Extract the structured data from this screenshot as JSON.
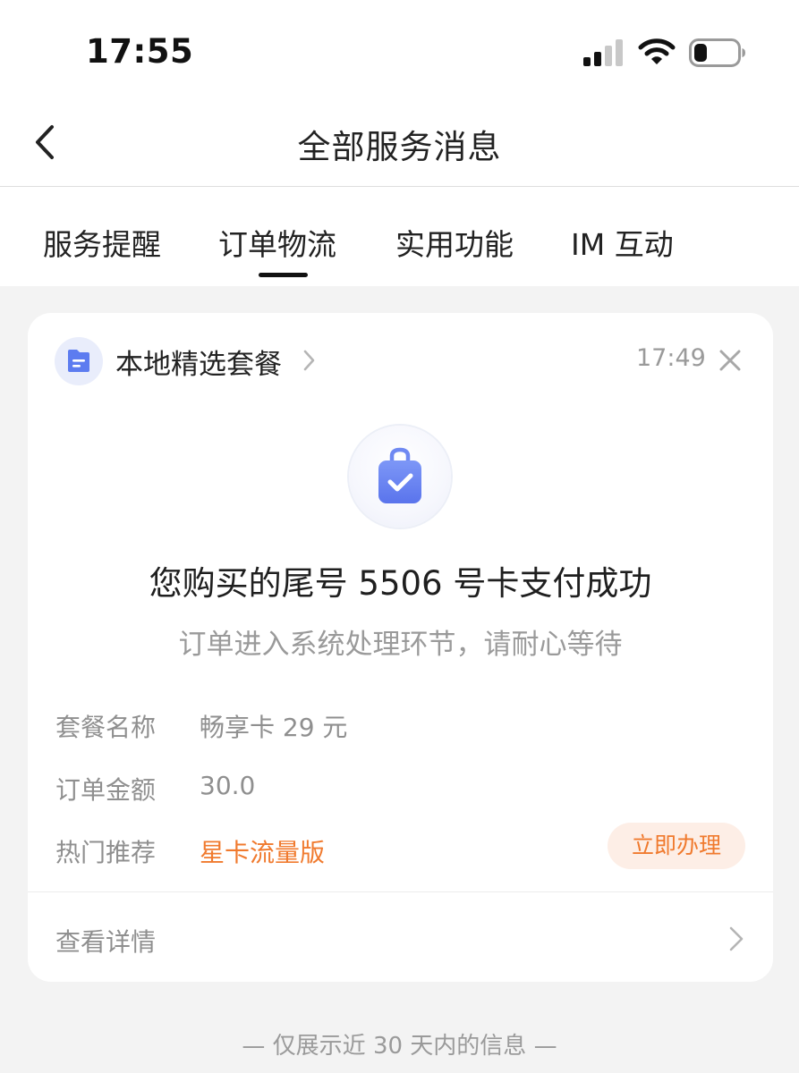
{
  "status_bar": {
    "time": "17:55"
  },
  "nav": {
    "title": "全部服务消息"
  },
  "tabs": [
    {
      "label": "服务提醒"
    },
    {
      "label": "订单物流"
    },
    {
      "label": "实用功能"
    },
    {
      "label": "IM 互动"
    }
  ],
  "active_tab_index": 1,
  "message": {
    "source": "本地精选套餐",
    "time": "17:49",
    "headline": "您购买的尾号 5506 号卡支付成功",
    "subline": "订单进入系统处理环节，请耐心等待",
    "details": [
      {
        "label": "套餐名称",
        "value": "畅享卡 29 元"
      },
      {
        "label": "订单金额",
        "value": "30.0"
      },
      {
        "label": "热门推荐",
        "value": "星卡流量版"
      }
    ],
    "action_label": "立即办理",
    "view_details_label": "查看详情"
  },
  "footer": {
    "note": "— 仅展示近 30 天内的信息 —"
  },
  "colors": {
    "accent_orange": "#f07a2e",
    "icon_blue": "#5d7cf0",
    "background": "#f3f3f3"
  },
  "icons": {
    "back": "chevron-left-icon",
    "source": "document-icon",
    "dismiss": "close-icon",
    "hero": "shopping-bag-check-icon",
    "view_details": "chevron-right-icon"
  }
}
